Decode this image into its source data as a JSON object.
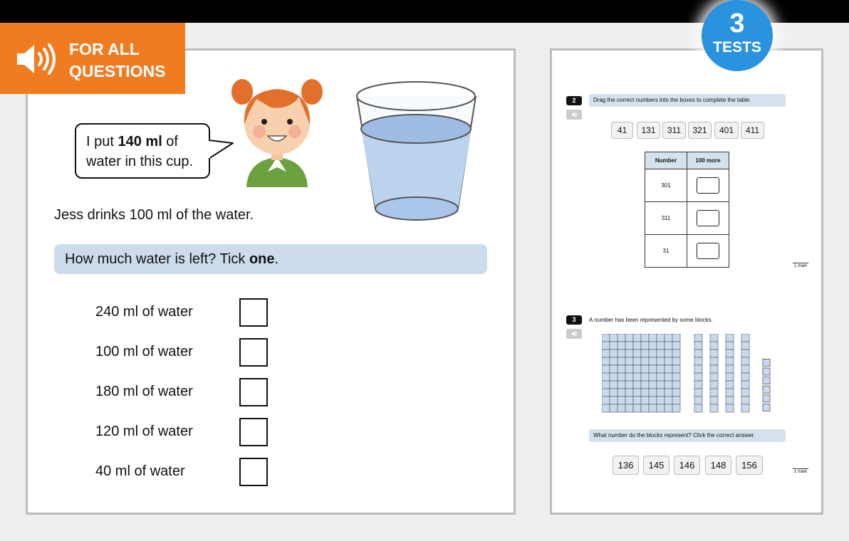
{
  "banner": {
    "line1": "FOR ALL",
    "line2": "QUESTIONS",
    "icon": "speaker-icon",
    "color": "#f07c22"
  },
  "badge": {
    "number": "3",
    "label": "TESTS",
    "color": "#2a93e0"
  },
  "main": {
    "bubble": {
      "pre": "I put ",
      "bold": "140 ml",
      "post": " of",
      "line2": "water in this cup."
    },
    "statement": "Jess drinks 100 ml of the water.",
    "question": {
      "pre": "How much water is left? Tick ",
      "bold": "one",
      "post": "."
    },
    "options": [
      "240 ml of water",
      "100 ml of water",
      "180 ml of water",
      "120 ml of water",
      "40 ml of water"
    ]
  },
  "side": {
    "q2": {
      "number": "2",
      "instruction": "Drag the correct numbers into the boxes to complete the table.",
      "chips": [
        "41",
        "131",
        "311",
        "321",
        "401",
        "411"
      ],
      "table": {
        "headers": [
          "Number",
          "100 more"
        ],
        "rows": [
          "301",
          "311",
          "31"
        ]
      },
      "mark": "1 mark"
    },
    "q3": {
      "number": "3",
      "instruction": "A number has been represented by some blocks.",
      "blocks": {
        "hundreds": 1,
        "tens": 4,
        "ones": 6
      },
      "question": "What number do the blocks represent? Click the correct answer.",
      "choices": [
        "136",
        "145",
        "146",
        "148",
        "156"
      ],
      "mark": "1 mark"
    }
  }
}
